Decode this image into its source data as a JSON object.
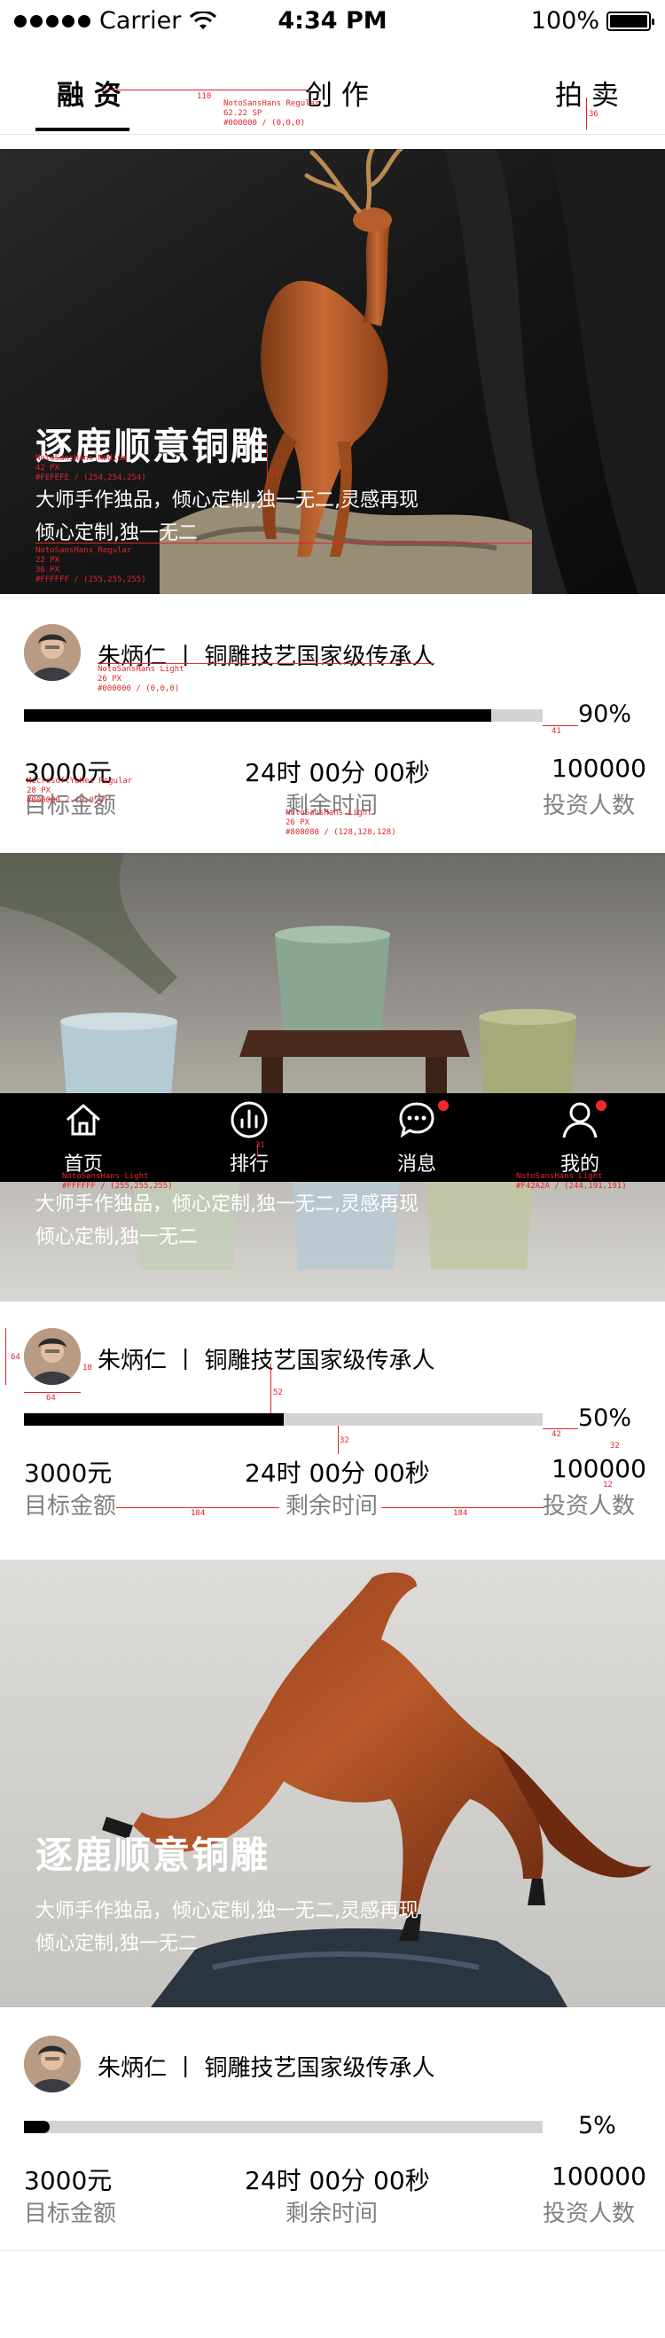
{
  "status_bar": {
    "carrier": "Carrier",
    "time": "4:34 PM",
    "battery": "100%"
  },
  "top_tabs": [
    {
      "label": "融 资",
      "active": true
    },
    {
      "label": "创 作",
      "active": false
    },
    {
      "label": "拍 卖",
      "active": false
    }
  ],
  "cards": [
    {
      "title": "逐鹿顺意铜雕",
      "desc_line1": "大师手作独品，倾心定制,独一无二,灵感再现",
      "desc_line2": "倾心定制,独一无二",
      "author": "朱炳仁 丨 铜雕技艺国家级传承人",
      "progress": 0.9,
      "percent_text": "90%",
      "amount": "3000元",
      "amount_label": "目标金额",
      "time": "24时 00分 00秒",
      "time_label": "剩余时间",
      "investors": "100000",
      "investors_label": "投资人数"
    },
    {
      "title": "",
      "desc_line1": "大师手作独品，倾心定制,独一无二,灵感再现",
      "desc_line2": "倾心定制,独一无二",
      "author": "朱炳仁 丨 铜雕技艺国家级传承人",
      "progress": 0.5,
      "percent_text": "50%",
      "amount": "3000元",
      "amount_label": "目标金额",
      "time": "24时 00分 00秒",
      "time_label": "剩余时间",
      "investors": "100000",
      "investors_label": "投资人数"
    },
    {
      "title": "逐鹿顺意铜雕",
      "desc_line1": "大师手作独品，倾心定制,独一无二,灵感再现",
      "desc_line2": "倾心定制,独一无二",
      "author": "朱炳仁 丨 铜雕技艺国家级传承人",
      "progress": 0.05,
      "percent_text": "5%",
      "amount": "3000元",
      "amount_label": "目标金额",
      "time": "24时 00分 00秒",
      "time_label": "剩余时间",
      "investors": "100000",
      "investors_label": "投资人数"
    }
  ],
  "bottom_nav": [
    {
      "label": "首页",
      "icon": "home-icon",
      "badge": false
    },
    {
      "label": "排行",
      "icon": "ranking-icon",
      "badge": false
    },
    {
      "label": "消息",
      "icon": "message-icon",
      "badge": true
    },
    {
      "label": "我的",
      "icon": "profile-icon",
      "badge": true
    }
  ],
  "spec_notes": {
    "tab_gap": "110",
    "tab_font": "NotoSansHans Regular",
    "tab_size": "62.22 SP",
    "tab_color": "#000000 / (0,0,0)",
    "tab_height": "36",
    "title_font": "NotoSansHans Medium",
    "title_size": "42 PX",
    "title_color": "#FEFEFE / (254,254,254)",
    "title_gap": "31",
    "desc_font": "NotoSansHans Regular",
    "desc_size": "22 PX",
    "desc_line": "36 PX",
    "desc_color": "#FFFFFF / (255,255,255)",
    "author_font": "NotoSansHans Light",
    "author_size": "26 PX",
    "author_color": "#000000 / (0,0,0)",
    "percent_gap": "41",
    "amount_font": "MicrosoftYaHei Regular",
    "amount_size": "28 PX",
    "amount_color": "#000000 / (0,0,0)",
    "label_font": "NotoSansHans Light",
    "label_size": "26 PX",
    "label_color": "#808080 / (128,128,128)",
    "nav_font": "NotoSansHans Light",
    "nav_font_right": "NotoSansHans Light",
    "nav_color": "#FFFFFF / (255,255,255)",
    "nav_badge_color": "#F42A2A / (244,191,191)",
    "nav_gap": "31",
    "avatar_size": "64",
    "avatar_width": "64",
    "avatar_gap": "18",
    "author_top": "52",
    "bar_gap": "32",
    "bar_gap_right": "42",
    "percent_top": "32",
    "percent_bottom": "12",
    "stat_gap_left": "184",
    "stat_gap_right": "184"
  }
}
